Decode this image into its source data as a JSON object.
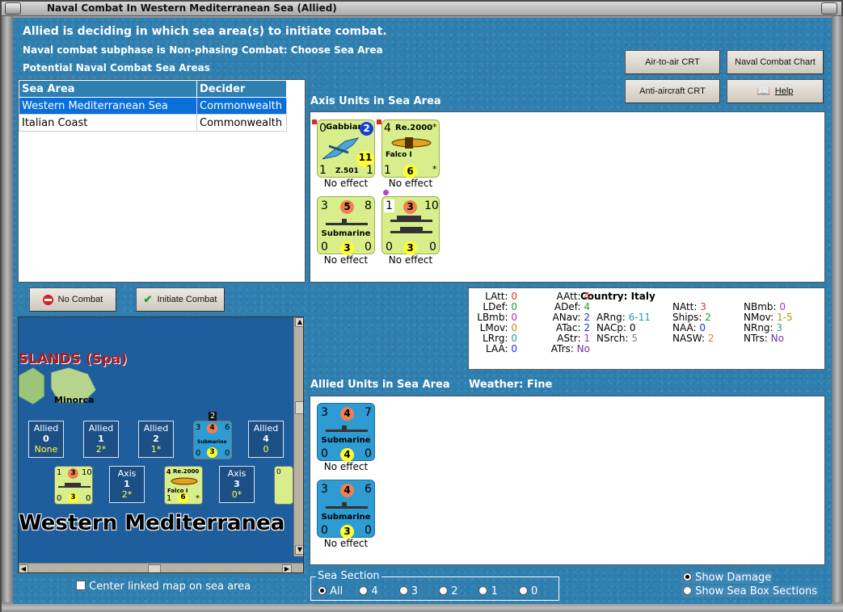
{
  "window": {
    "title": "Naval Combat In Western Mediterranean Sea (Allied)"
  },
  "header": {
    "line1": "Allied is deciding in which sea area(s) to initiate combat.",
    "line2": "Naval combat subphase is Non-phasing Combat: Choose Sea Area",
    "line3": "Potential Naval Combat Sea Areas"
  },
  "buttons": {
    "air_to_air": "Air-to-air CRT",
    "naval_chart": "Naval Combat Chart",
    "anti_aircraft": "Anti-aircraft CRT",
    "help": "Help",
    "no_combat": "No Combat",
    "initiate_combat": "Initiate Combat"
  },
  "sea_table": {
    "columns": [
      "Sea Area",
      "Decider"
    ],
    "rows": [
      {
        "area": "Western Mediterranean Sea",
        "decider": "Commonwealth",
        "selected": true
      },
      {
        "area": "Italian Coast",
        "decider": "Commonwealth",
        "selected": false
      }
    ]
  },
  "axis_panel": {
    "title": "Axis Units in Sea Area",
    "units": [
      {
        "tl": "0",
        "name": "Gabbiano",
        "circle": "2",
        "big": "11",
        "bl": "1",
        "model": "Z.501",
        "br": "1",
        "effect": "No effect"
      },
      {
        "tl": "4",
        "name": "Re.2000",
        "star": "*",
        "sub": "Falco I",
        "bl": "1",
        "circle": "6",
        "br": "*",
        "effect": "No effect"
      },
      {
        "tl": "3",
        "circle_top": "5",
        "tr": "8",
        "name": "Submarine",
        "bl": "0",
        "circle": "3",
        "br": "0",
        "effect": "No effect"
      },
      {
        "tl": "1",
        "circle_top": "3",
        "tr": "10",
        "bl": "0",
        "circle": "3",
        "br": "0",
        "effect": "No effect"
      }
    ]
  },
  "stats": {
    "country_label": "Country: Italy",
    "col1": [
      {
        "k": "LAtt:",
        "v": "0",
        "c": "#e03030"
      },
      {
        "k": "LDef:",
        "v": "0",
        "c": "#20a020"
      },
      {
        "k": "LBmb:",
        "v": "0",
        "c": "#b030c0"
      },
      {
        "k": "LMov:",
        "v": "0",
        "c": "#c09000"
      },
      {
        "k": "LRrg:",
        "v": "0",
        "c": "#20a0a0"
      },
      {
        "k": "LAA:",
        "v": "0",
        "c": "#2030e0"
      }
    ],
    "col2": [
      {
        "k": "AAtt:",
        "v": "4",
        "c": "#e03030"
      },
      {
        "k": "ADef:",
        "v": "4",
        "c": "#20a020"
      },
      {
        "k": "ANav:",
        "v": "2",
        "c": "#2030e0"
      },
      {
        "k": "ATac:",
        "v": "2",
        "c": "#2030e0"
      },
      {
        "k": "AStr:",
        "v": "1",
        "c": "#b030c0"
      },
      {
        "k": "ATrs:",
        "v": "No",
        "c": "#7030a0"
      }
    ],
    "col3": [
      {
        "k": "ARng:",
        "v": "6-11",
        "c": "#20a0a0"
      },
      {
        "k": "NACp:",
        "v": "0",
        "c": "#000000"
      },
      {
        "k": "NSrch:",
        "v": "5",
        "c": "#808080"
      }
    ],
    "col4": [
      {
        "k": "NAtt:",
        "v": "3",
        "c": "#e03030"
      },
      {
        "k": "Ships:",
        "v": "2",
        "c": "#20a020"
      },
      {
        "k": "NAA:",
        "v": "0",
        "c": "#2030e0"
      },
      {
        "k": "NASW:",
        "v": "2",
        "c": "#e08020"
      }
    ],
    "col5": [
      {
        "k": "NBmb:",
        "v": "0",
        "c": "#b030c0"
      },
      {
        "k": "NMov:",
        "v": "1-5",
        "c": "#c09000"
      },
      {
        "k": "NRng:",
        "v": "3",
        "c": "#20a0a0"
      },
      {
        "k": "NTrs:",
        "v": "No",
        "c": "#7030a0"
      }
    ]
  },
  "allied_panel": {
    "title": "Allied Units in Sea Area",
    "weather": "Weather:  Fine",
    "units": [
      {
        "tl": "3",
        "circle_top": "4",
        "tr": "7",
        "name": "Submarine",
        "bl": "0",
        "circle": "4",
        "br": "0",
        "effect": "No effect"
      },
      {
        "tl": "3",
        "circle_top": "4",
        "tr": "6",
        "name": "Submarine",
        "bl": "0",
        "circle": "3",
        "br": "0",
        "effect": "No effect"
      }
    ]
  },
  "map": {
    "region_label": "SLANDS (Spa)",
    "island_label": "Minorca",
    "sea_label": "Western Mediterranea",
    "allied_boxes": [
      {
        "title": "Allied",
        "n": "0",
        "v": "None"
      },
      {
        "title": "Allied",
        "n": "1",
        "v": "2*"
      },
      {
        "title": "Allied",
        "n": "2",
        "v": "1*"
      },
      {
        "title": "Allied",
        "n": "4",
        "v": "0"
      }
    ],
    "axis_boxes": [
      {
        "title": "Axis",
        "n": "1",
        "v": "2*"
      },
      {
        "title": "Axis",
        "n": "3",
        "v": "0*"
      }
    ],
    "mini_sub": {
      "badge": "2",
      "tl": "3",
      "c": "4",
      "tr": "6",
      "name": "Submarine",
      "bl": "0",
      "c2": "3",
      "br": "0"
    },
    "mini_axis_ship": {
      "tl": "1",
      "c": "3",
      "tr": "10",
      "bl": "0",
      "c2": "3",
      "br": "0"
    },
    "mini_axis_plane": {
      "tl": "4",
      "name": "Re.2000",
      "sub": "Falco I",
      "bl": "1",
      "c2": "6",
      "br": "*"
    },
    "mini_partial": "0"
  },
  "footer": {
    "center_map": "Center linked map on sea area",
    "sea_section_label": "Sea Section",
    "sea_section_options": [
      "All",
      "4",
      "3",
      "2",
      "1",
      "0"
    ],
    "show_damage": "Show Damage",
    "show_sea_box": "Show Sea Box Sections"
  }
}
